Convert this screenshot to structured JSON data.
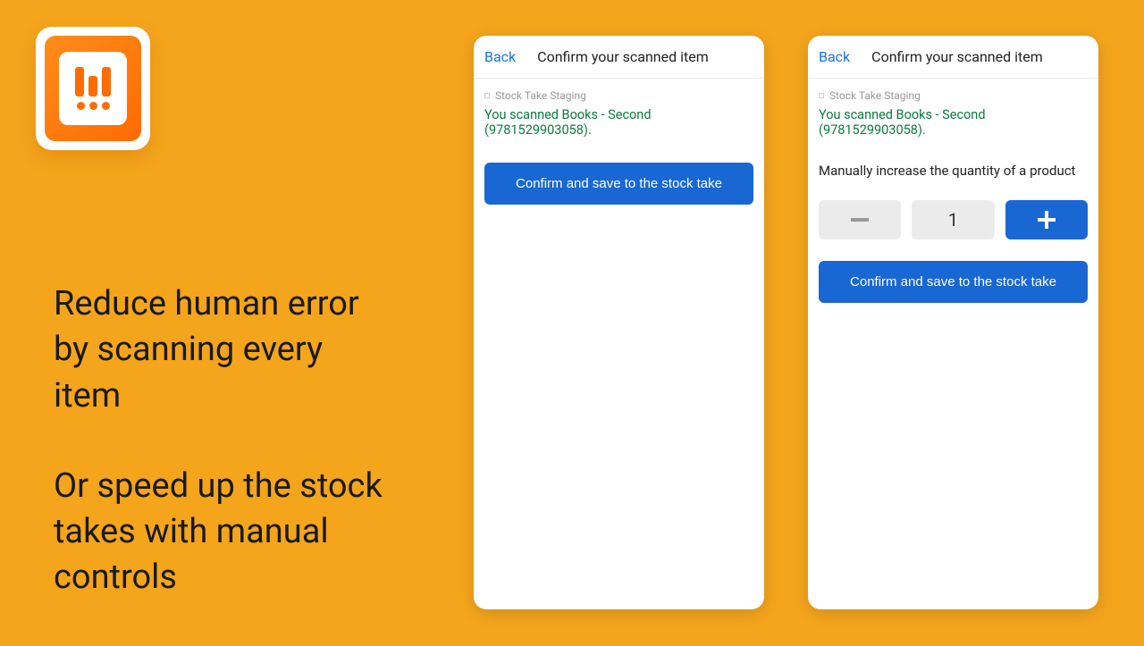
{
  "marketing": {
    "line1": "Reduce human error by scanning every item",
    "line2": "Or speed up the stock takes with manual controls"
  },
  "screen_simple": {
    "back": "Back",
    "title": "Confirm your scanned item",
    "breadcrumb": "Stock Take Staging",
    "scanned": "You scanned Books - Second (9781529903058).",
    "confirm": "Confirm and save to the stock take"
  },
  "screen_manual": {
    "back": "Back",
    "title": "Confirm your scanned item",
    "breadcrumb": "Stock Take Staging",
    "scanned": "You scanned Books - Second (9781529903058).",
    "manual_label": "Manually increase the quantity of a product",
    "quantity": "1",
    "confirm": "Confirm and save to the stock take"
  },
  "colors": {
    "background": "#F4A51C",
    "primary_button": "#1967d2",
    "link": "#1a73e8",
    "success_text": "#0b7a3e"
  }
}
